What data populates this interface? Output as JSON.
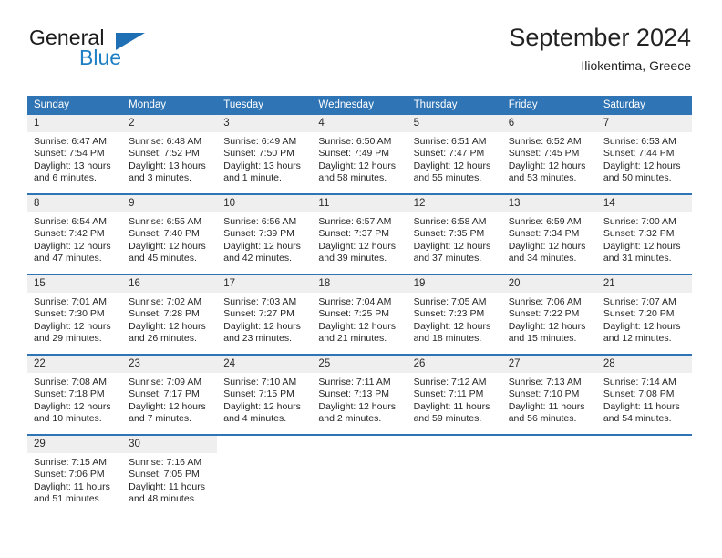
{
  "brand": {
    "word1": "General",
    "word2": "Blue",
    "flag_icon": "triangle-flag-icon",
    "blue_hex": "#1f7fc4"
  },
  "header": {
    "title": "September 2024",
    "subtitle": "Iliokentima, Greece",
    "accent_hex": "#2f74b5"
  },
  "calendar": {
    "weekdays": [
      "Sunday",
      "Monday",
      "Tuesday",
      "Wednesday",
      "Thursday",
      "Friday",
      "Saturday"
    ],
    "weeks": [
      [
        {
          "day": "1",
          "sunrise": "Sunrise: 6:47 AM",
          "sunset": "Sunset: 7:54 PM",
          "daylight1": "Daylight: 13 hours",
          "daylight2": "and 6 minutes."
        },
        {
          "day": "2",
          "sunrise": "Sunrise: 6:48 AM",
          "sunset": "Sunset: 7:52 PM",
          "daylight1": "Daylight: 13 hours",
          "daylight2": "and 3 minutes."
        },
        {
          "day": "3",
          "sunrise": "Sunrise: 6:49 AM",
          "sunset": "Sunset: 7:50 PM",
          "daylight1": "Daylight: 13 hours",
          "daylight2": "and 1 minute."
        },
        {
          "day": "4",
          "sunrise": "Sunrise: 6:50 AM",
          "sunset": "Sunset: 7:49 PM",
          "daylight1": "Daylight: 12 hours",
          "daylight2": "and 58 minutes."
        },
        {
          "day": "5",
          "sunrise": "Sunrise: 6:51 AM",
          "sunset": "Sunset: 7:47 PM",
          "daylight1": "Daylight: 12 hours",
          "daylight2": "and 55 minutes."
        },
        {
          "day": "6",
          "sunrise": "Sunrise: 6:52 AM",
          "sunset": "Sunset: 7:45 PM",
          "daylight1": "Daylight: 12 hours",
          "daylight2": "and 53 minutes."
        },
        {
          "day": "7",
          "sunrise": "Sunrise: 6:53 AM",
          "sunset": "Sunset: 7:44 PM",
          "daylight1": "Daylight: 12 hours",
          "daylight2": "and 50 minutes."
        }
      ],
      [
        {
          "day": "8",
          "sunrise": "Sunrise: 6:54 AM",
          "sunset": "Sunset: 7:42 PM",
          "daylight1": "Daylight: 12 hours",
          "daylight2": "and 47 minutes."
        },
        {
          "day": "9",
          "sunrise": "Sunrise: 6:55 AM",
          "sunset": "Sunset: 7:40 PM",
          "daylight1": "Daylight: 12 hours",
          "daylight2": "and 45 minutes."
        },
        {
          "day": "10",
          "sunrise": "Sunrise: 6:56 AM",
          "sunset": "Sunset: 7:39 PM",
          "daylight1": "Daylight: 12 hours",
          "daylight2": "and 42 minutes."
        },
        {
          "day": "11",
          "sunrise": "Sunrise: 6:57 AM",
          "sunset": "Sunset: 7:37 PM",
          "daylight1": "Daylight: 12 hours",
          "daylight2": "and 39 minutes."
        },
        {
          "day": "12",
          "sunrise": "Sunrise: 6:58 AM",
          "sunset": "Sunset: 7:35 PM",
          "daylight1": "Daylight: 12 hours",
          "daylight2": "and 37 minutes."
        },
        {
          "day": "13",
          "sunrise": "Sunrise: 6:59 AM",
          "sunset": "Sunset: 7:34 PM",
          "daylight1": "Daylight: 12 hours",
          "daylight2": "and 34 minutes."
        },
        {
          "day": "14",
          "sunrise": "Sunrise: 7:00 AM",
          "sunset": "Sunset: 7:32 PM",
          "daylight1": "Daylight: 12 hours",
          "daylight2": "and 31 minutes."
        }
      ],
      [
        {
          "day": "15",
          "sunrise": "Sunrise: 7:01 AM",
          "sunset": "Sunset: 7:30 PM",
          "daylight1": "Daylight: 12 hours",
          "daylight2": "and 29 minutes."
        },
        {
          "day": "16",
          "sunrise": "Sunrise: 7:02 AM",
          "sunset": "Sunset: 7:28 PM",
          "daylight1": "Daylight: 12 hours",
          "daylight2": "and 26 minutes."
        },
        {
          "day": "17",
          "sunrise": "Sunrise: 7:03 AM",
          "sunset": "Sunset: 7:27 PM",
          "daylight1": "Daylight: 12 hours",
          "daylight2": "and 23 minutes."
        },
        {
          "day": "18",
          "sunrise": "Sunrise: 7:04 AM",
          "sunset": "Sunset: 7:25 PM",
          "daylight1": "Daylight: 12 hours",
          "daylight2": "and 21 minutes."
        },
        {
          "day": "19",
          "sunrise": "Sunrise: 7:05 AM",
          "sunset": "Sunset: 7:23 PM",
          "daylight1": "Daylight: 12 hours",
          "daylight2": "and 18 minutes."
        },
        {
          "day": "20",
          "sunrise": "Sunrise: 7:06 AM",
          "sunset": "Sunset: 7:22 PM",
          "daylight1": "Daylight: 12 hours",
          "daylight2": "and 15 minutes."
        },
        {
          "day": "21",
          "sunrise": "Sunrise: 7:07 AM",
          "sunset": "Sunset: 7:20 PM",
          "daylight1": "Daylight: 12 hours",
          "daylight2": "and 12 minutes."
        }
      ],
      [
        {
          "day": "22",
          "sunrise": "Sunrise: 7:08 AM",
          "sunset": "Sunset: 7:18 PM",
          "daylight1": "Daylight: 12 hours",
          "daylight2": "and 10 minutes."
        },
        {
          "day": "23",
          "sunrise": "Sunrise: 7:09 AM",
          "sunset": "Sunset: 7:17 PM",
          "daylight1": "Daylight: 12 hours",
          "daylight2": "and 7 minutes."
        },
        {
          "day": "24",
          "sunrise": "Sunrise: 7:10 AM",
          "sunset": "Sunset: 7:15 PM",
          "daylight1": "Daylight: 12 hours",
          "daylight2": "and 4 minutes."
        },
        {
          "day": "25",
          "sunrise": "Sunrise: 7:11 AM",
          "sunset": "Sunset: 7:13 PM",
          "daylight1": "Daylight: 12 hours",
          "daylight2": "and 2 minutes."
        },
        {
          "day": "26",
          "sunrise": "Sunrise: 7:12 AM",
          "sunset": "Sunset: 7:11 PM",
          "daylight1": "Daylight: 11 hours",
          "daylight2": "and 59 minutes."
        },
        {
          "day": "27",
          "sunrise": "Sunrise: 7:13 AM",
          "sunset": "Sunset: 7:10 PM",
          "daylight1": "Daylight: 11 hours",
          "daylight2": "and 56 minutes."
        },
        {
          "day": "28",
          "sunrise": "Sunrise: 7:14 AM",
          "sunset": "Sunset: 7:08 PM",
          "daylight1": "Daylight: 11 hours",
          "daylight2": "and 54 minutes."
        }
      ],
      [
        {
          "day": "29",
          "sunrise": "Sunrise: 7:15 AM",
          "sunset": "Sunset: 7:06 PM",
          "daylight1": "Daylight: 11 hours",
          "daylight2": "and 51 minutes."
        },
        {
          "day": "30",
          "sunrise": "Sunrise: 7:16 AM",
          "sunset": "Sunset: 7:05 PM",
          "daylight1": "Daylight: 11 hours",
          "daylight2": "and 48 minutes."
        },
        {
          "day": "",
          "sunrise": "",
          "sunset": "",
          "daylight1": "",
          "daylight2": ""
        },
        {
          "day": "",
          "sunrise": "",
          "sunset": "",
          "daylight1": "",
          "daylight2": ""
        },
        {
          "day": "",
          "sunrise": "",
          "sunset": "",
          "daylight1": "",
          "daylight2": ""
        },
        {
          "day": "",
          "sunrise": "",
          "sunset": "",
          "daylight1": "",
          "daylight2": ""
        },
        {
          "day": "",
          "sunrise": "",
          "sunset": "",
          "daylight1": "",
          "daylight2": ""
        }
      ]
    ]
  }
}
